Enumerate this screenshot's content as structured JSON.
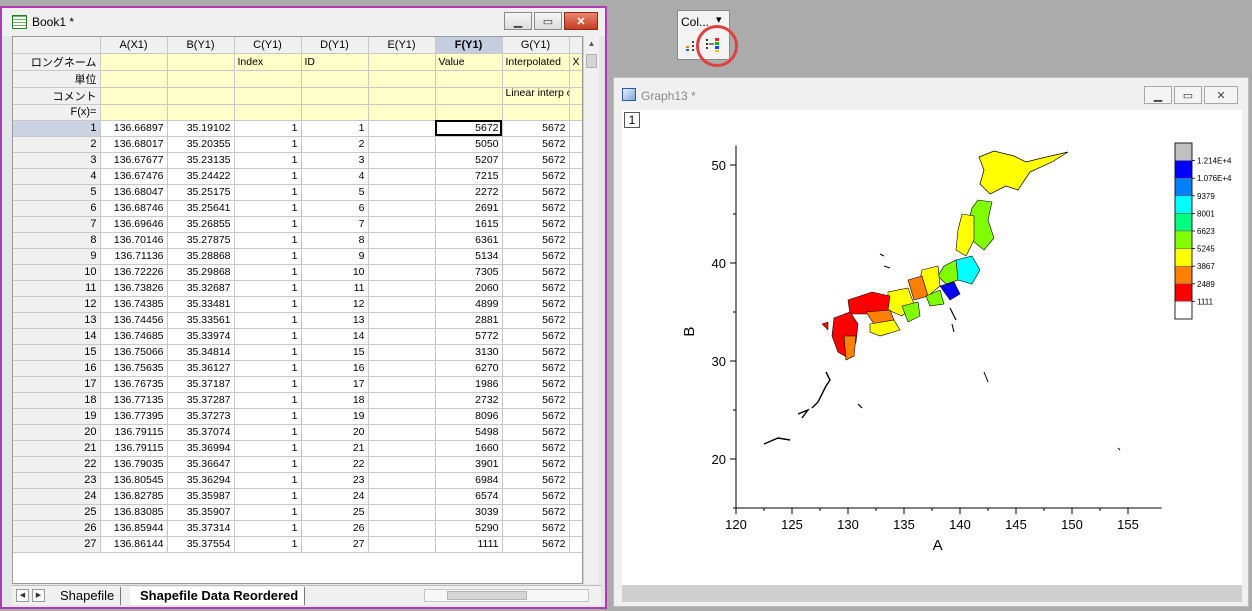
{
  "workbook": {
    "title": "Book1 *",
    "columns": [
      {
        "header": "A(X1)",
        "long_name": "",
        "unit": "",
        "comment": "",
        "selected": false
      },
      {
        "header": "B(Y1)",
        "long_name": "",
        "unit": "",
        "comment": "",
        "selected": false
      },
      {
        "header": "C(Y1)",
        "long_name": "Index",
        "unit": "",
        "comment": "",
        "selected": false
      },
      {
        "header": "D(Y1)",
        "long_name": "ID",
        "unit": "",
        "comment": "",
        "selected": false
      },
      {
        "header": "E(Y1)",
        "long_name": "",
        "unit": "",
        "comment": "",
        "selected": false
      },
      {
        "header": "F(Y1)",
        "long_name": "Value",
        "unit": "",
        "comment": "",
        "selected": true
      },
      {
        "header": "G(Y1)",
        "long_name": "Interpolated",
        "unit": "",
        "comment": "Linear interp of “Value”",
        "selected": false
      },
      {
        "header": "",
        "long_name": "X",
        "unit": "",
        "comment": "",
        "selected": false
      }
    ],
    "row_labels": {
      "long_name": "ロングネーム",
      "unit": "単位",
      "comment": "コメント",
      "formula": "F(x)="
    },
    "rows": [
      [
        "1",
        "136.66897",
        "35.19102",
        "1",
        "1",
        "",
        "5672",
        "5672"
      ],
      [
        "2",
        "136.68017",
        "35.20355",
        "1",
        "2",
        "",
        "5050",
        "5672"
      ],
      [
        "3",
        "136.67677",
        "35.23135",
        "1",
        "3",
        "",
        "5207",
        "5672"
      ],
      [
        "4",
        "136.67476",
        "35.24422",
        "1",
        "4",
        "",
        "7215",
        "5672"
      ],
      [
        "5",
        "136.68047",
        "35.25175",
        "1",
        "5",
        "",
        "2272",
        "5672"
      ],
      [
        "6",
        "136.68746",
        "35.25641",
        "1",
        "6",
        "",
        "2691",
        "5672"
      ],
      [
        "7",
        "136.69646",
        "35.26855",
        "1",
        "7",
        "",
        "1615",
        "5672"
      ],
      [
        "8",
        "136.70146",
        "35.27875",
        "1",
        "8",
        "",
        "6361",
        "5672"
      ],
      [
        "9",
        "136.71136",
        "35.28868",
        "1",
        "9",
        "",
        "5134",
        "5672"
      ],
      [
        "10",
        "136.72226",
        "35.29868",
        "1",
        "10",
        "",
        "7305",
        "5672"
      ],
      [
        "11",
        "136.73826",
        "35.32687",
        "1",
        "11",
        "",
        "2060",
        "5672"
      ],
      [
        "12",
        "136.74385",
        "35.33481",
        "1",
        "12",
        "",
        "4899",
        "5672"
      ],
      [
        "13",
        "136.74456",
        "35.33561",
        "1",
        "13",
        "",
        "2881",
        "5672"
      ],
      [
        "14",
        "136.74685",
        "35.33974",
        "1",
        "14",
        "",
        "5772",
        "5672"
      ],
      [
        "15",
        "136.75066",
        "35.34814",
        "1",
        "15",
        "",
        "3130",
        "5672"
      ],
      [
        "16",
        "136.75635",
        "35.36127",
        "1",
        "16",
        "",
        "6270",
        "5672"
      ],
      [
        "17",
        "136.76735",
        "35.37187",
        "1",
        "17",
        "",
        "1986",
        "5672"
      ],
      [
        "18",
        "136.77135",
        "35.37287",
        "1",
        "18",
        "",
        "2732",
        "5672"
      ],
      [
        "19",
        "136.77395",
        "35.37273",
        "1",
        "19",
        "",
        "8096",
        "5672"
      ],
      [
        "20",
        "136.79115",
        "35.37074",
        "1",
        "20",
        "",
        "5498",
        "5672"
      ],
      [
        "21",
        "136.79115",
        "35.36994",
        "1",
        "21",
        "",
        "1660",
        "5672"
      ],
      [
        "22",
        "136.79035",
        "35.36647",
        "1",
        "22",
        "",
        "3901",
        "5672"
      ],
      [
        "23",
        "136.80545",
        "35.36294",
        "1",
        "23",
        "",
        "6984",
        "5672"
      ],
      [
        "24",
        "136.82785",
        "35.35987",
        "1",
        "24",
        "",
        "6574",
        "5672"
      ],
      [
        "25",
        "136.83085",
        "35.35907",
        "1",
        "25",
        "",
        "3039",
        "5672"
      ],
      [
        "26",
        "136.85944",
        "35.37314",
        "1",
        "26",
        "",
        "5290",
        "5672"
      ],
      [
        "27",
        "136.86144",
        "35.37554",
        "1",
        "27",
        "",
        "1111",
        "5672"
      ]
    ],
    "sheet_tabs": [
      {
        "label": "Shapefile",
        "active": false
      },
      {
        "label": "Shapefile Data Reordered",
        "active": true
      }
    ]
  },
  "toolbar": {
    "label": "Col...",
    "chevron": "chevron-down-icon",
    "icons": [
      "color-scale-icon",
      "set-colormap-icon"
    ]
  },
  "graph": {
    "title": "Graph13 *",
    "layer_label": "1",
    "chart_data": {
      "type": "map",
      "xlabel": "A",
      "ylabel": "B",
      "xlim": [
        120,
        158
      ],
      "ylim": [
        15,
        52
      ],
      "x_ticks": [
        "120",
        "125",
        "130",
        "135",
        "140",
        "145",
        "150",
        "155"
      ],
      "y_ticks": [
        "20",
        "30",
        "40",
        "50"
      ],
      "colorbar_levels": [
        "1.214E+4",
        "1.076E+4",
        "9379",
        "8001",
        "6623",
        "5245",
        "3867",
        "2489",
        "1111"
      ],
      "colorbar_colors": [
        "#c0c0c0",
        "#0000ff",
        "#0080ff",
        "#00ffff",
        "#00ff80",
        "#80ff00",
        "#ffff00",
        "#ff8000",
        "#ff0000",
        "#ffffff"
      ]
    }
  }
}
